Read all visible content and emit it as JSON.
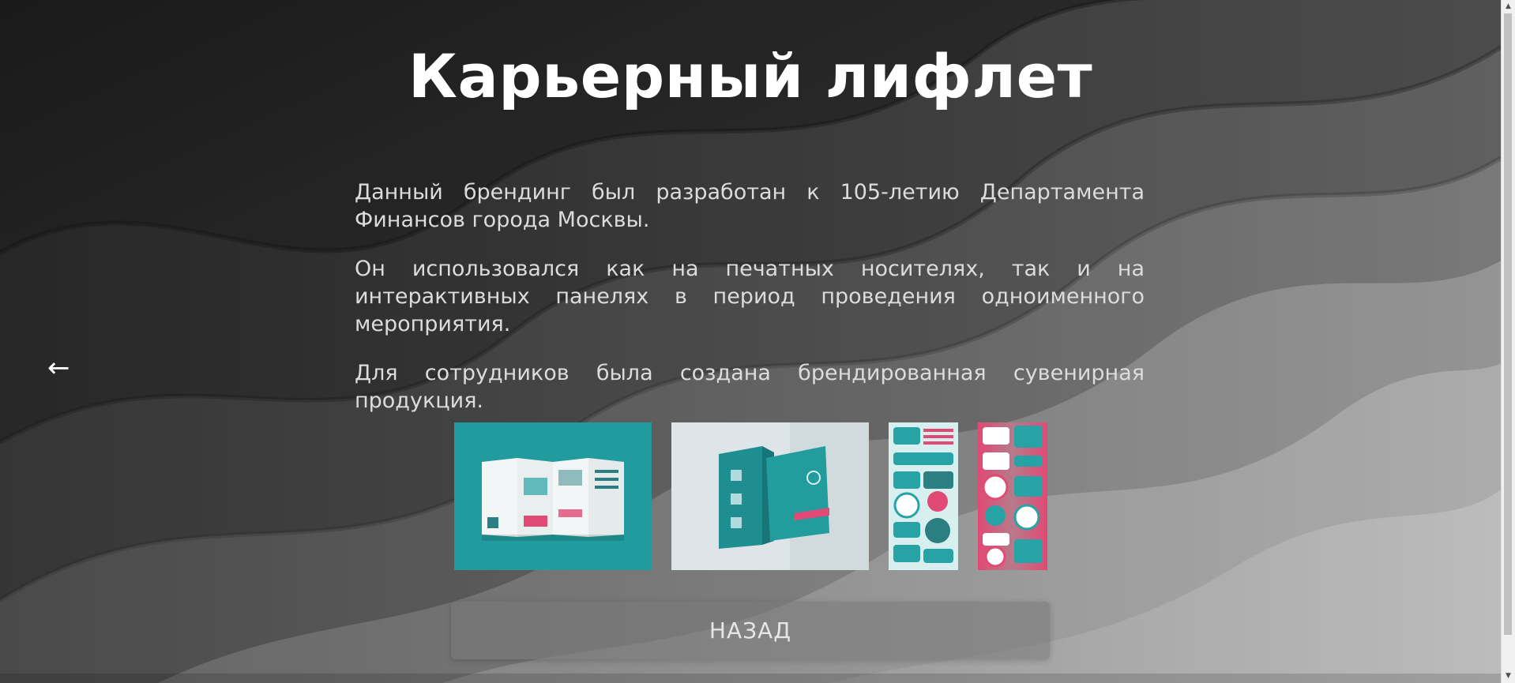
{
  "page": {
    "title": "Карьерный лифлет",
    "paragraphs": [
      "Данный брендинг был разработан к 105-летию Департамента Финансов города Москвы.",
      "Он использовался как на печатных носителях, так и на интерактивных панелях в период проведения одноименного мероприятия.",
      "Для сотрудников была создана брендированная сувенирная продукция."
    ],
    "back_arrow": "←",
    "back_button_label": "НАЗАД"
  },
  "gallery": [
    {
      "icon": "leaflet-spread-image"
    },
    {
      "icon": "leaflet-folded-image"
    },
    {
      "icon": "sticker-sheet-teal-image"
    },
    {
      "icon": "sticker-sheet-pink-image"
    }
  ],
  "colors": {
    "accent_teal": "#27a3a6",
    "accent_pink": "#e04a74",
    "title": "#ffffff",
    "text": "#dcdcdc"
  },
  "scrollbar": {
    "up": "▲",
    "down": "▼"
  }
}
